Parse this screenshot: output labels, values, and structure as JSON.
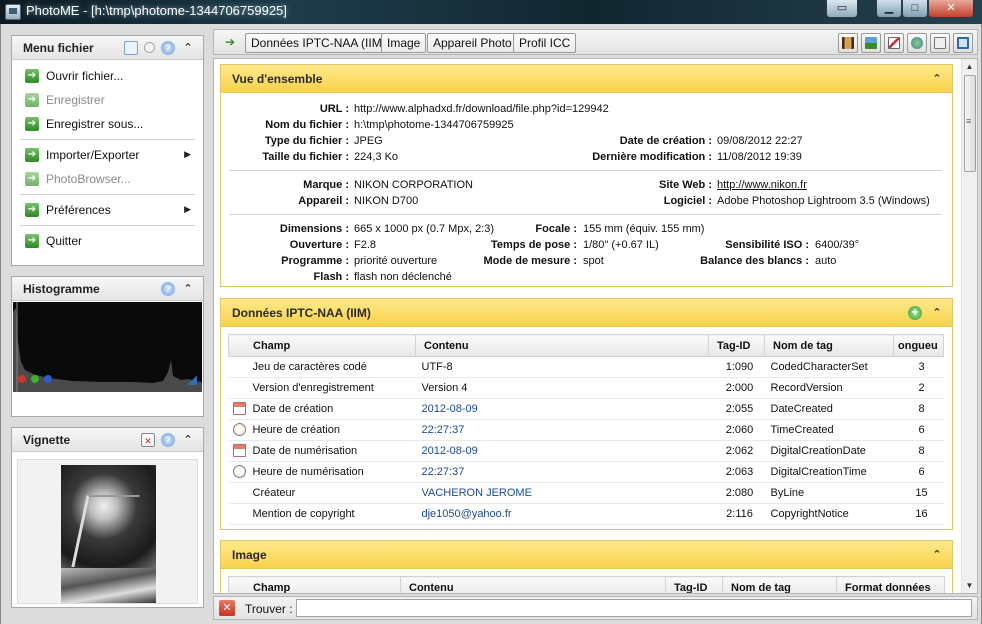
{
  "window": {
    "title": "PhotoME - [h:\\tmp\\photome-1344706759925]"
  },
  "left": {
    "menu": {
      "title": "Menu fichier",
      "items": [
        {
          "label": "Ouvrir fichier...",
          "enabled": true
        },
        {
          "label": "Enregistrer",
          "enabled": false
        },
        {
          "label": "Enregistrer sous...",
          "enabled": true
        },
        {
          "label": "Importer/Exporter",
          "enabled": true,
          "submenu": true
        },
        {
          "label": "PhotoBrowser...",
          "enabled": false
        },
        {
          "label": "Préférences",
          "enabled": true,
          "submenu": true
        },
        {
          "label": "Quitter",
          "enabled": true
        }
      ]
    },
    "histogram": {
      "title": "Histogramme"
    },
    "thumbnail": {
      "title": "Vignette"
    }
  },
  "toolbar": {
    "tabs": [
      "Données IPTC-NAA (IIM)",
      "Image",
      "Appareil Photo",
      "Profil ICC"
    ]
  },
  "overview": {
    "title": "Vue d'ensemble",
    "url_label": "URL :",
    "url": "http://www.alphadxd.fr/download/file.php?id=129942",
    "filename_label": "Nom du fichier :",
    "filename": "h:\\tmp\\photome-1344706759925",
    "filetype_label": "Type du fichier :",
    "filetype": "JPEG",
    "filesize_label": "Taille du fichier :",
    "filesize": "224,3 Ko",
    "created_label": "Date de création :",
    "created": "09/08/2012 22:27",
    "modified_label": "Dernière modification :",
    "modified": "11/08/2012 19:39",
    "brand_label": "Marque :",
    "brand": "NIKON CORPORATION",
    "camera_label": "Appareil :",
    "camera": "NIKON D700",
    "website_label": "Site Web :",
    "website": "http://www.nikon.fr",
    "software_label": "Logiciel :",
    "software": "Adobe Photoshop Lightroom 3.5 (Windows)",
    "dimensions_label": "Dimensions :",
    "dimensions": "665 x 1000 px (0.7 Mpx, 2:3)",
    "aperture_label": "Ouverture :",
    "aperture": "F2.8",
    "program_label": "Programme :",
    "program": "priorité ouverture",
    "flash_label": "Flash :",
    "flash": "flash non déclenché",
    "focal_label": "Focale :",
    "focal": "155 mm (équiv. 155 mm)",
    "exposure_label": "Temps de pose :",
    "exposure": "1/80\" (+0.67 IL)",
    "metering_label": "Mode de mesure :",
    "metering": "spot",
    "iso_label": "Sensibilité ISO :",
    "iso": "6400/39°",
    "wb_label": "Balance des blancs :",
    "wb": "auto"
  },
  "iptc": {
    "title": "Données IPTC-NAA (IIM)",
    "columns": [
      "Champ",
      "Contenu",
      "Tag-ID",
      "Nom de tag",
      "ongueu"
    ],
    "rows": [
      {
        "field": "Jeu de caractères codé",
        "content": "UTF-8",
        "tag": "1:090",
        "name": "CodedCharacterSet",
        "len": "3",
        "icon": ""
      },
      {
        "field": "Version d'enregistrement",
        "content": "Version 4",
        "tag": "2:000",
        "name": "RecordVersion",
        "len": "2",
        "icon": ""
      },
      {
        "field": "Date de création",
        "content": "2012-08-09",
        "tag": "2:055",
        "name": "DateCreated",
        "len": "8",
        "icon": "calendar"
      },
      {
        "field": "Heure de création",
        "content": "22:27:37",
        "tag": "2:060",
        "name": "TimeCreated",
        "len": "6",
        "icon": "clock"
      },
      {
        "field": "Date de numérisation",
        "content": "2012-08-09",
        "tag": "2:062",
        "name": "DigitalCreationDate",
        "len": "8",
        "icon": "calendar"
      },
      {
        "field": "Heure de numérisation",
        "content": "22:27:37",
        "tag": "2:063",
        "name": "DigitalCreationTime",
        "len": "6",
        "icon": "clock"
      },
      {
        "field": "Créateur",
        "content": "VACHERON JEROME",
        "tag": "2:080",
        "name": "ByLine",
        "len": "15",
        "icon": ""
      },
      {
        "field": "Mention de copyright",
        "content": "dje1050@yahoo.fr",
        "tag": "2:116",
        "name": "CopyrightNotice",
        "len": "16",
        "icon": ""
      }
    ]
  },
  "image_section": {
    "title": "Image",
    "columns": [
      "Champ",
      "Contenu",
      "Tag-ID",
      "Nom de tag",
      "Format données"
    ]
  },
  "findbar": {
    "label": "Trouver :",
    "value": "",
    "placeholder": ""
  }
}
